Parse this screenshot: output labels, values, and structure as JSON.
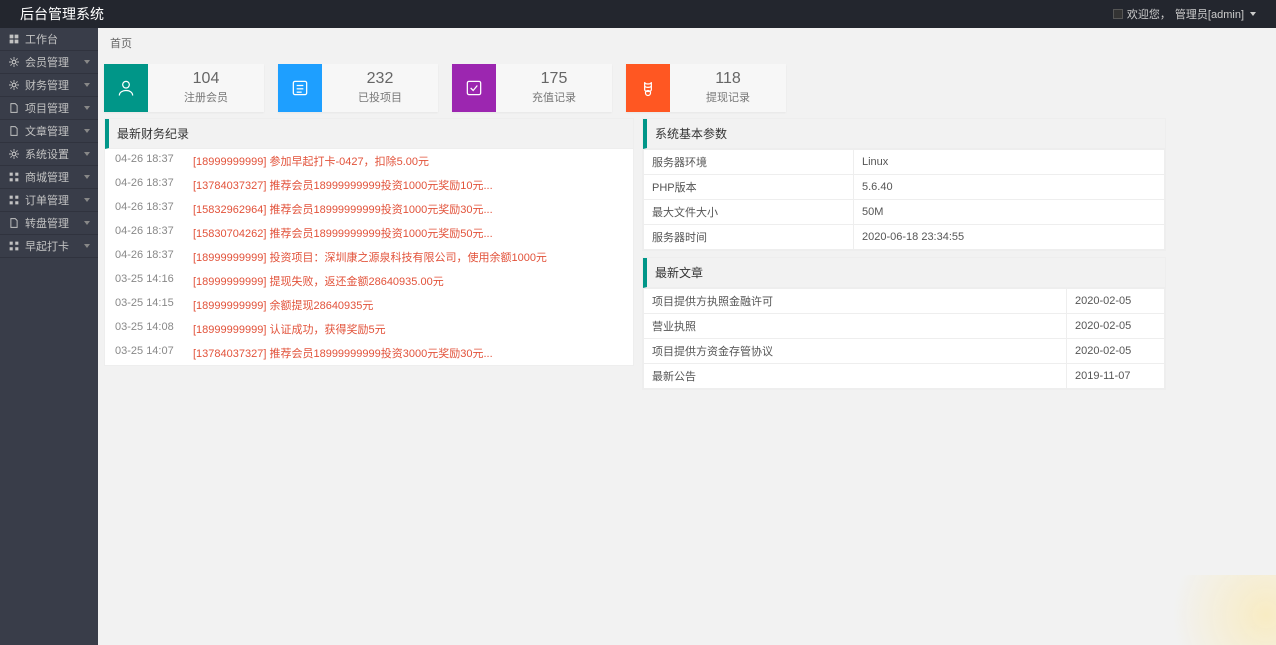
{
  "header": {
    "title": "后台管理系统",
    "welcome_prefix": "欢迎您，",
    "role_user": "管理员[admin]"
  },
  "breadcrumb": "首页",
  "sidebar": {
    "items": [
      {
        "label": "工作台",
        "has_children": false,
        "icon": "dashboard"
      },
      {
        "label": "会员管理",
        "has_children": true,
        "icon": "gear"
      },
      {
        "label": "财务管理",
        "has_children": true,
        "icon": "gear"
      },
      {
        "label": "项目管理",
        "has_children": true,
        "icon": "file"
      },
      {
        "label": "文章管理",
        "has_children": true,
        "icon": "file"
      },
      {
        "label": "系统设置",
        "has_children": true,
        "icon": "gear"
      },
      {
        "label": "商城管理",
        "has_children": true,
        "icon": "grid"
      },
      {
        "label": "订单管理",
        "has_children": true,
        "icon": "grid"
      },
      {
        "label": "转盘管理",
        "has_children": true,
        "icon": "file"
      },
      {
        "label": "早起打卡",
        "has_children": true,
        "icon": "grid"
      }
    ]
  },
  "stats": [
    {
      "value": "104",
      "label": "注册会员",
      "color": "c-green",
      "icon": "user"
    },
    {
      "value": "232",
      "label": "已投项目",
      "color": "c-blue",
      "icon": "list"
    },
    {
      "value": "175",
      "label": "充值记录",
      "color": "c-purple",
      "icon": "check"
    },
    {
      "value": "118",
      "label": "提现记录",
      "color": "c-orange",
      "icon": "money"
    }
  ],
  "panels": {
    "finance_title": "最新财务纪录",
    "sysinfo_title": "系统基本参数",
    "articles_title": "最新文章"
  },
  "finance_records": [
    {
      "date": "04-26 18:37",
      "text": "[18999999999] 参加早起打卡-0427，扣除5.00元"
    },
    {
      "date": "04-26 18:37",
      "text": "[13784037327] 推荐会员18999999999投资1000元奖励10元..."
    },
    {
      "date": "04-26 18:37",
      "text": "[15832962964] 推荐会员18999999999投资1000元奖励30元..."
    },
    {
      "date": "04-26 18:37",
      "text": "[15830704262] 推荐会员18999999999投资1000元奖励50元..."
    },
    {
      "date": "04-26 18:37",
      "text": "[18999999999] 投资项目：深圳康之源泉科技有限公司，使用余额1000元"
    },
    {
      "date": "03-25 14:16",
      "text": "[18999999999] 提现失败，返还金额28640935.00元"
    },
    {
      "date": "03-25 14:15",
      "text": "[18999999999] 余额提现28640935元"
    },
    {
      "date": "03-25 14:08",
      "text": "[18999999999] 认证成功，获得奖励5元"
    },
    {
      "date": "03-25 14:07",
      "text": "[13784037327] 推荐会员18999999999投资3000元奖励30元..."
    }
  ],
  "sys_params": [
    {
      "k": "服务器环境",
      "v": "Linux"
    },
    {
      "k": "PHP版本",
      "v": "5.6.40"
    },
    {
      "k": "最大文件大小",
      "v": "50M"
    },
    {
      "k": "服务器时间",
      "v": "2020-06-18 23:34:55"
    }
  ],
  "articles": [
    {
      "title": "项目提供方执照金融许可",
      "date": "2020-02-05"
    },
    {
      "title": "营业执照",
      "date": "2020-02-05"
    },
    {
      "title": "项目提供方资金存管协议",
      "date": "2020-02-05"
    },
    {
      "title": "最新公告",
      "date": "2019-11-07"
    }
  ]
}
